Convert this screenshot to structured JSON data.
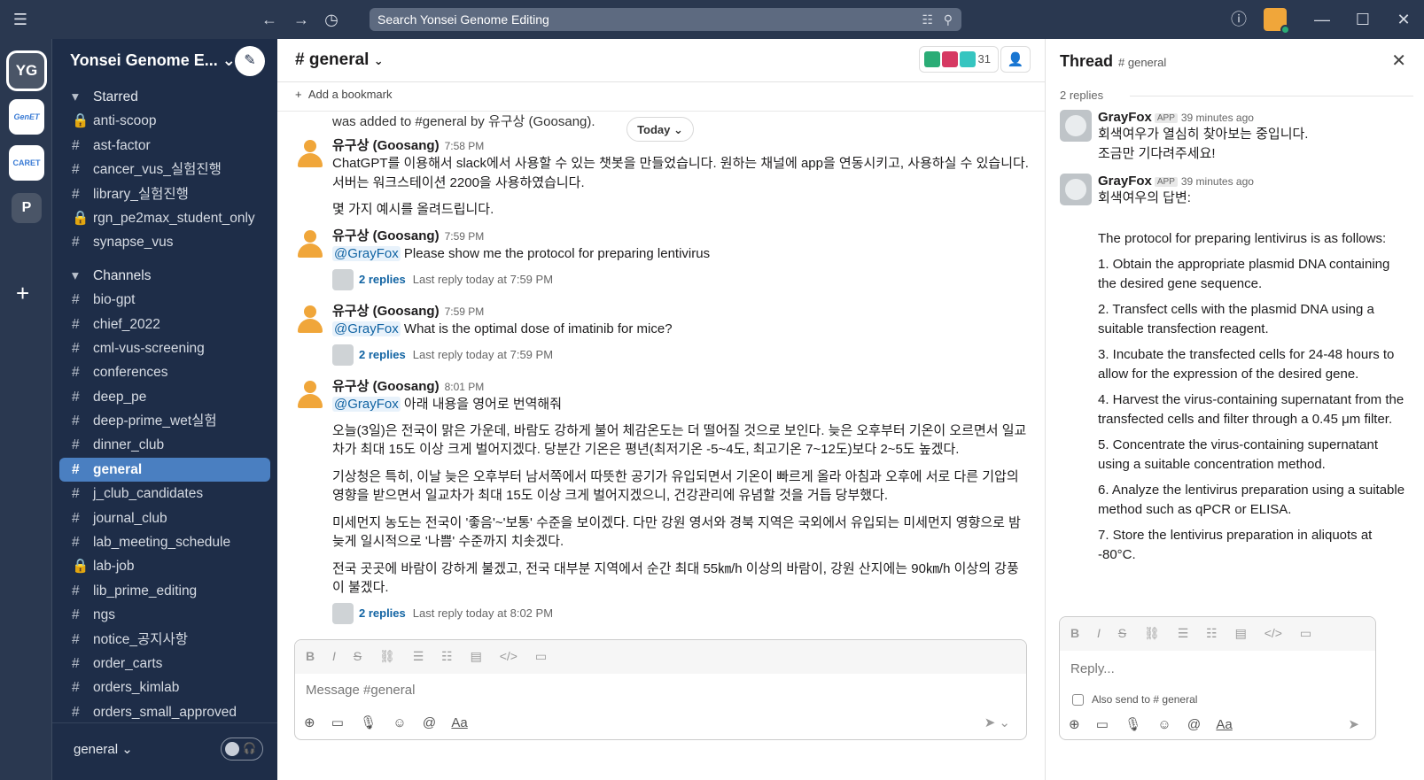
{
  "topbar": {
    "search_placeholder": "Search Yonsei Genome Editing",
    "icons": [
      "menu-icon",
      "back-icon",
      "forward-icon",
      "history-icon",
      "filter-icon",
      "search-icon",
      "help-icon",
      "minimize-icon",
      "maximize-icon",
      "close-icon"
    ]
  },
  "rail": {
    "workspaces": [
      {
        "label": "YG"
      },
      {
        "label": "GenET"
      },
      {
        "label": "CARET"
      },
      {
        "label": "P"
      }
    ],
    "add": "+"
  },
  "sidebar": {
    "workspace_name": "Yonsei Genome E...",
    "sections": {
      "starred": "Starred",
      "channels": "Channels"
    },
    "starred": [
      {
        "prefix": "🔒",
        "label": "anti-scoop"
      },
      {
        "prefix": "#",
        "label": "ast-factor"
      },
      {
        "prefix": "#",
        "label": "cancer_vus_실험진행"
      },
      {
        "prefix": "#",
        "label": "library_실험진행"
      },
      {
        "prefix": "🔒",
        "label": "rgn_pe2max_student_only"
      },
      {
        "prefix": "#",
        "label": "synapse_vus"
      }
    ],
    "channels": [
      {
        "prefix": "#",
        "label": "bio-gpt"
      },
      {
        "prefix": "#",
        "label": "chief_2022"
      },
      {
        "prefix": "#",
        "label": "cml-vus-screening"
      },
      {
        "prefix": "#",
        "label": "conferences"
      },
      {
        "prefix": "#",
        "label": "deep_pe"
      },
      {
        "prefix": "#",
        "label": "deep-prime_wet실험"
      },
      {
        "prefix": "#",
        "label": "dinner_club"
      },
      {
        "prefix": "#",
        "label": "general"
      },
      {
        "prefix": "#",
        "label": "j_club_candidates"
      },
      {
        "prefix": "#",
        "label": "journal_club"
      },
      {
        "prefix": "#",
        "label": "lab_meeting_schedule"
      },
      {
        "prefix": "🔒",
        "label": "lab-job"
      },
      {
        "prefix": "#",
        "label": "lib_prime_editing"
      },
      {
        "prefix": "#",
        "label": "ngs"
      },
      {
        "prefix": "#",
        "label": "notice_공지사항"
      },
      {
        "prefix": "#",
        "label": "order_carts"
      },
      {
        "prefix": "#",
        "label": "orders_kimlab"
      },
      {
        "prefix": "#",
        "label": "orders_small_approved"
      }
    ],
    "footer_label": "general"
  },
  "main": {
    "channel_title": "# general",
    "member_count": "31",
    "add_bookmark": "Add a bookmark",
    "top_text": "was added to #general by 유구상 (Goosang).",
    "date_divider": "Today",
    "messages": [
      {
        "author": "유구상 (Goosang)",
        "time": "7:58 PM",
        "paragraphs": [
          "ChatGPT를 이용해서 slack에서 사용할 수 있는 챗봇을 만들었습니다. 원하는 채널에 app을 연동시키고, 사용하실 수 있습니다. 서버는 워크스테이션 2200을 사용하였습니다.",
          "몇 가지 예시를 올려드립니다."
        ]
      },
      {
        "author": "유구상 (Goosang)",
        "time": "7:59 PM",
        "mention": "@GrayFox",
        "text": "Please show me the protocol for preparing lentivirus",
        "replies": "2 replies",
        "last_reply": "Last reply today at 7:59 PM"
      },
      {
        "author": "유구상 (Goosang)",
        "time": "7:59 PM",
        "mention": "@GrayFox",
        "text": "What is the optimal dose of imatinib for mice?",
        "replies": "2 replies",
        "last_reply": "Last reply today at 7:59 PM"
      },
      {
        "author": "유구상 (Goosang)",
        "time": "8:01 PM",
        "mention": "@GrayFox",
        "text": "아래 내용을 영어로 번역해줘",
        "paragraphs": [
          "오늘(3일)은 전국이 맑은 가운데, 바람도 강하게 불어 체감온도는 더 떨어질 것으로 보인다. 늦은 오후부터 기온이 오르면서 일교차가 최대 15도 이상 크게 벌어지겠다. 당분간 기온은 평년(최저기온 -5~4도, 최고기온 7~12도)보다 2~5도 높겠다.",
          "기상청은 특히, 이날 늦은 오후부터 남서쪽에서 따뜻한 공기가 유입되면서 기온이 빠르게 올라 아침과 오후에 서로 다른 기압의 영향을 받으면서 일교차가 최대 15도 이상 크게 벌어지겠으니, 건강관리에 유념할 것을 거듭 당부했다.",
          "미세먼지 농도는 전국이 '좋음'~'보통' 수준을 보이겠다. 다만 강원 영서와 경북 지역은 국외에서 유입되는 미세먼지 영향으로 밤 늦게 일시적으로 '나쁨' 수준까지 치솟겠다.",
          "전국 곳곳에 바람이 강하게 불겠고, 전국 대부분 지역에서 순간 최대 55㎞/h 이상의 바람이, 강원 산지에는 90㎞/h 이상의 강풍이 불겠다."
        ],
        "replies": "2 replies",
        "last_reply": "Last reply today at 8:02 PM"
      }
    ],
    "composer_placeholder": "Message #general",
    "aa": "Aa"
  },
  "thread": {
    "title": "Thread",
    "channel": "# general",
    "reply_count": "2 replies",
    "messages": [
      {
        "author": "GrayFox",
        "badge": "APP",
        "time": "39 minutes ago",
        "lines": [
          "회색여우가 열심히 찾아보는 중입니다.",
          "조금만 기다려주세요!"
        ]
      },
      {
        "author": "GrayFox",
        "badge": "APP",
        "time": "39 minutes ago",
        "intro": "회색여우의 답변:",
        "paragraphs": [
          "The protocol for preparing lentivirus is as follows:",
          "1. Obtain the appropriate plasmid DNA containing the desired gene sequence.",
          "2. Transfect cells with the plasmid DNA using a suitable transfection reagent.",
          "3. Incubate the transfected cells for 24-48 hours to allow for the expression of the desired gene.",
          "4. Harvest the virus-containing supernatant from the transfected cells and filter through a 0.45 μm filter.",
          "5. Concentrate the virus-containing supernatant using a suitable concentration method.",
          "6. Analyze the lentivirus preparation using a suitable method such as qPCR or ELISA.",
          "7. Store the lentivirus preparation in aliquots at -80°C."
        ]
      }
    ],
    "reply_placeholder": "Reply...",
    "also_send": "Also send to",
    "also_channel": "# general",
    "aa": "Aa"
  },
  "colors": {
    "topbar": "#2a3850",
    "sidebar": "#1e2d48",
    "active": "#4a7fc1",
    "link": "#1264a3"
  }
}
